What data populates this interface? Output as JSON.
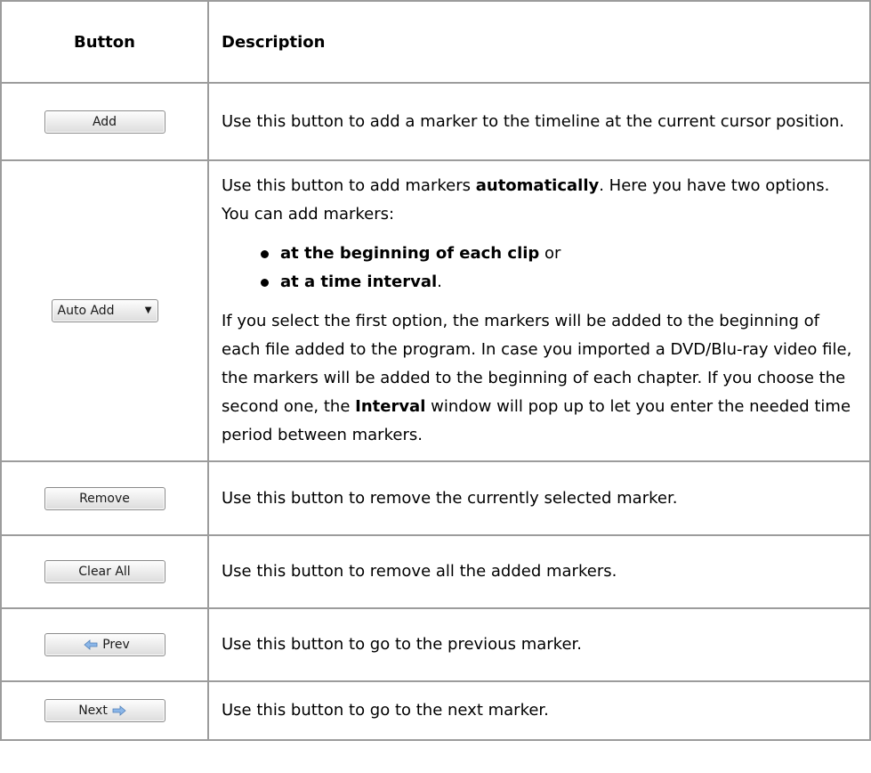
{
  "table": {
    "headers": {
      "button": "Button",
      "description": "Description"
    },
    "rows": {
      "add": {
        "button_label": "Add",
        "description": "Use this button to add a marker to the timeline at the current cursor position."
      },
      "auto_add": {
        "button_label": "Auto Add",
        "intro_pre": "Use this button to add markers ",
        "intro_bold": "automatically",
        "intro_post": ". Here you have two options. You can add markers:",
        "option1_bold": "at the beginning of each clip",
        "option1_post": " or",
        "option2_bold": "at a time interval",
        "option2_post": ".",
        "detail_pre": "If you select the first option, the markers will be added to the beginning of each file added to the program. In case you imported a DVD/Blu-ray video file, the markers will be added to the beginning of each chapter. If you choose the second one, the ",
        "detail_bold": "Interval",
        "detail_post": " window will pop up to let you enter the needed time period between markers."
      },
      "remove": {
        "button_label": "Remove",
        "description": "Use this button to remove the currently selected marker."
      },
      "clear_all": {
        "button_label": "Clear All",
        "description": "Use this button to remove all the added markers."
      },
      "prev": {
        "button_label": "Prev",
        "icon": "left-arrow-icon",
        "description": "Use this button to go to the previous marker."
      },
      "next": {
        "button_label": "Next",
        "icon": "right-arrow-icon",
        "description": "Use this button to go to the next marker."
      }
    }
  },
  "colors": {
    "border": "#9c9c9c",
    "arrow_fill": "#8ab6e8"
  }
}
